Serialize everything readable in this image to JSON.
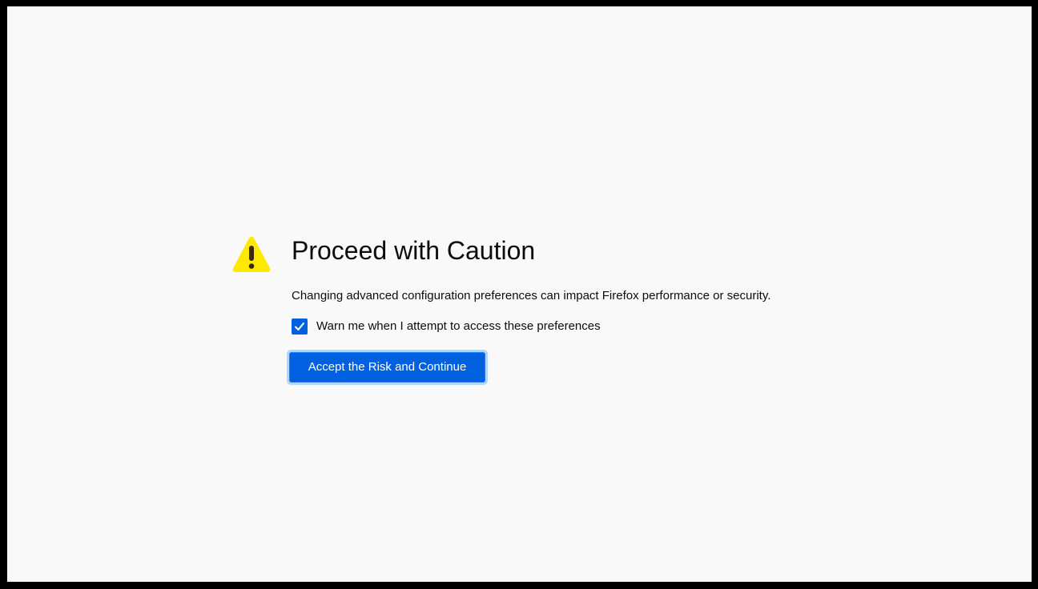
{
  "colors": {
    "page_background": "#f9f9fa",
    "frame": "#000000",
    "accent": "#0060df",
    "warning_yellow": "#ffe900",
    "text": "#0c0c0d"
  },
  "page": {
    "icon": "warning-triangle-icon",
    "title": "Proceed with Caution",
    "description": "Changing advanced configuration preferences can impact Firefox performance or security.",
    "checkbox": {
      "label": "Warn me when I attempt to access these preferences",
      "checked": true,
      "icon": "checkmark-icon"
    },
    "accept_button_label": "Accept the Risk and Continue"
  }
}
